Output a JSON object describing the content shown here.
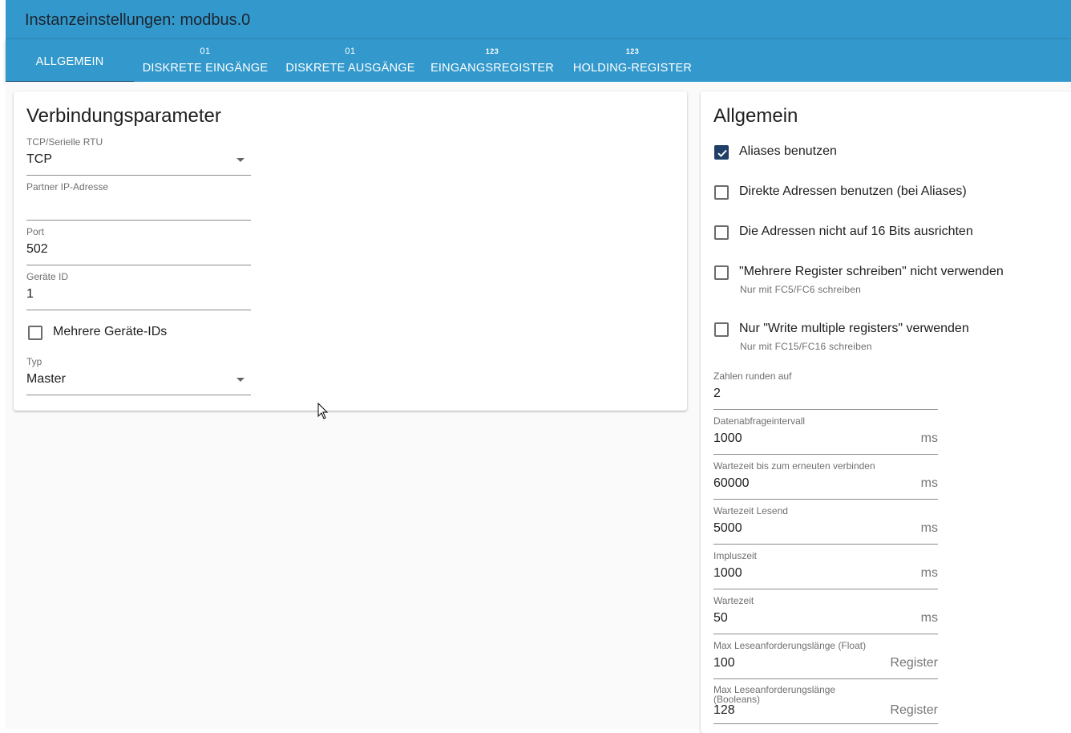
{
  "header": {
    "title": "Instanzeinstellungen: modbus.0"
  },
  "tabs": [
    {
      "label": "ALLGEMEIN",
      "badge": ""
    },
    {
      "label": "DISKRETE EINGÄNGE",
      "badge": "01"
    },
    {
      "label": "DISKRETE AUSGÄNGE",
      "badge": "01"
    },
    {
      "label": "EINGANGSREGISTER",
      "badge": "123"
    },
    {
      "label": "HOLDING-REGISTER",
      "badge": "123"
    }
  ],
  "left": {
    "title": "Verbindungsparameter",
    "mode": {
      "label": "TCP/Serielle RTU",
      "value": "TCP"
    },
    "ip": {
      "label": "Partner IP-Adresse",
      "value": ""
    },
    "port": {
      "label": "Port",
      "value": "502"
    },
    "device_id": {
      "label": "Geräte ID",
      "value": "1"
    },
    "multi_ids": {
      "label": "Mehrere Geräte-IDs",
      "checked": false
    },
    "type": {
      "label": "Typ",
      "value": "Master"
    }
  },
  "right": {
    "title": "Allgemein",
    "checks": [
      {
        "label": "Aliases benutzen",
        "checked": true,
        "hint": ""
      },
      {
        "label": "Direkte Adressen benutzen (bei Aliases)",
        "checked": false,
        "hint": ""
      },
      {
        "label": "Die Adressen nicht auf 16 Bits ausrichten",
        "checked": false,
        "hint": ""
      },
      {
        "label": "\"Mehrere Register schreiben\" nicht verwenden",
        "checked": false,
        "hint": "Nur mit FC5/FC6 schreiben"
      },
      {
        "label": "Nur \"Write multiple registers\" verwenden",
        "checked": false,
        "hint": "Nur mit FC15/FC16 schreiben"
      }
    ],
    "fields": [
      {
        "label": "Zahlen runden auf",
        "value": "2",
        "unit": ""
      },
      {
        "label": "Datenabfrageintervall",
        "value": "1000",
        "unit": "ms"
      },
      {
        "label": "Wartezeit bis zum erneuten verbinden",
        "value": "60000",
        "unit": "ms"
      },
      {
        "label": "Wartezeit Lesend",
        "value": "5000",
        "unit": "ms"
      },
      {
        "label": "Impluszeit",
        "value": "1000",
        "unit": "ms"
      },
      {
        "label": "Wartezeit",
        "value": "50",
        "unit": "ms"
      },
      {
        "label": "Max Leseanforderungslänge (Float)",
        "value": "100",
        "unit": "Register"
      },
      {
        "label": "Max Leseanforderungslänge (Booleans)",
        "value": "128",
        "unit": "Register"
      }
    ]
  },
  "colors": {
    "header": "#3399cc",
    "checkbox": "#1f3e68"
  }
}
